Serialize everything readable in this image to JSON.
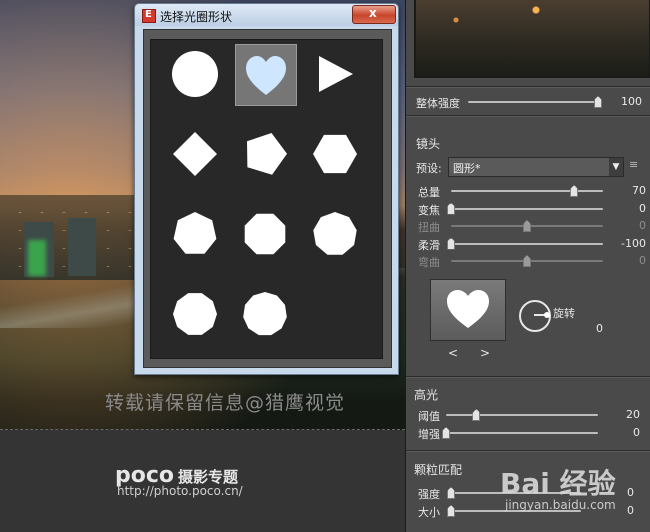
{
  "dialog": {
    "title": "选择光圈形状",
    "close_label": "x",
    "shapes": [
      {
        "name": "circle",
        "selected": false
      },
      {
        "name": "heart",
        "selected": true
      },
      {
        "name": "triangle",
        "selected": false
      },
      {
        "name": "square-rotated",
        "selected": false
      },
      {
        "name": "pentagon",
        "selected": false
      },
      {
        "name": "hexagon",
        "selected": false
      },
      {
        "name": "heptagon",
        "selected": false
      },
      {
        "name": "octagon",
        "selected": false
      },
      {
        "name": "nonagon",
        "selected": false
      },
      {
        "name": "decagon",
        "selected": false
      },
      {
        "name": "hendecagon",
        "selected": false
      }
    ]
  },
  "panel": {
    "overall": {
      "label": "整体强度",
      "value": "100",
      "level": 1.0
    },
    "lens": {
      "title": "镜头",
      "preset_label": "预设:",
      "preset_value": "圆形*",
      "sliders": [
        {
          "label": "总量",
          "value": "70",
          "level": 0.81,
          "enabled": true
        },
        {
          "label": "变焦",
          "value": "0",
          "level": 0.0,
          "enabled": true
        },
        {
          "label": "扭曲",
          "value": "0",
          "level": 0.5,
          "enabled": false
        },
        {
          "label": "柔滑",
          "value": "-100",
          "level": 0.0,
          "enabled": true
        },
        {
          "label": "弯曲",
          "value": "0",
          "level": 0.5,
          "enabled": false
        }
      ],
      "rotation_label": "旋转",
      "rotation_value": "0",
      "prev": "<",
      "next": ">"
    },
    "highlight": {
      "title": "高光",
      "sliders": [
        {
          "label": "阈值",
          "value": "20",
          "level": 0.2
        },
        {
          "label": "增强",
          "value": "0",
          "level": 0.0
        }
      ]
    },
    "grain": {
      "title": "颗粒匹配",
      "sliders": [
        {
          "label": "强度",
          "value": "0",
          "level": 0.0
        },
        {
          "label": "大小",
          "value": "0",
          "level": 0.0
        }
      ]
    }
  },
  "watermarks": {
    "center": "转载请保留信息@猎鹰视觉",
    "poco": "poco",
    "poco_sub": "摄影专题",
    "poco_url": "http://photo.poco.cn/",
    "baidu": "Bai 经验",
    "baidu_url": "jingyan.baidu.com"
  },
  "colors": {
    "panel": "#4a4a4a",
    "grid": "#282828",
    "selected_cell": "#767676",
    "heart_fill": "#cfe6ff"
  }
}
